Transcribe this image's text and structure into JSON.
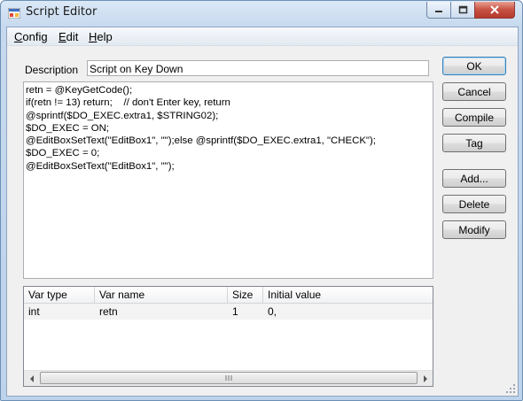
{
  "window": {
    "title": "Script Editor"
  },
  "menu": [
    {
      "key": "C",
      "rest": "onfig"
    },
    {
      "key": "E",
      "rest": "dit"
    },
    {
      "key": "H",
      "rest": "elp"
    }
  ],
  "description": {
    "label": "Description",
    "value": "Script on Key Down"
  },
  "code_lines": [
    "retn = @KeyGetCode();",
    "if(retn != 13) return;    // don't Enter key, return",
    "@sprintf($DO_EXEC.extra1, $STRING02);",
    "$DO_EXEC = ON;",
    "@EditBoxSetText(\"EditBox1\", \"\");else @sprintf($DO_EXEC.extra1, \"CHECK\");",
    "$DO_EXEC = 0;",
    "@EditBoxSetText(\"EditBox1\", \"\");"
  ],
  "buttons": {
    "ok": "OK",
    "cancel": "Cancel",
    "compile": "Compile",
    "tag": "Tag",
    "add": "Add...",
    "delete": "Delete",
    "modify": "Modify"
  },
  "variables": {
    "columns": [
      "Var type",
      "Var name",
      "Size",
      "Initial value"
    ],
    "rows": [
      [
        "int",
        "retn",
        "1",
        "0,"
      ]
    ]
  },
  "colors": {
    "close_button": "#c75142",
    "accent": "#3c7fb1"
  }
}
